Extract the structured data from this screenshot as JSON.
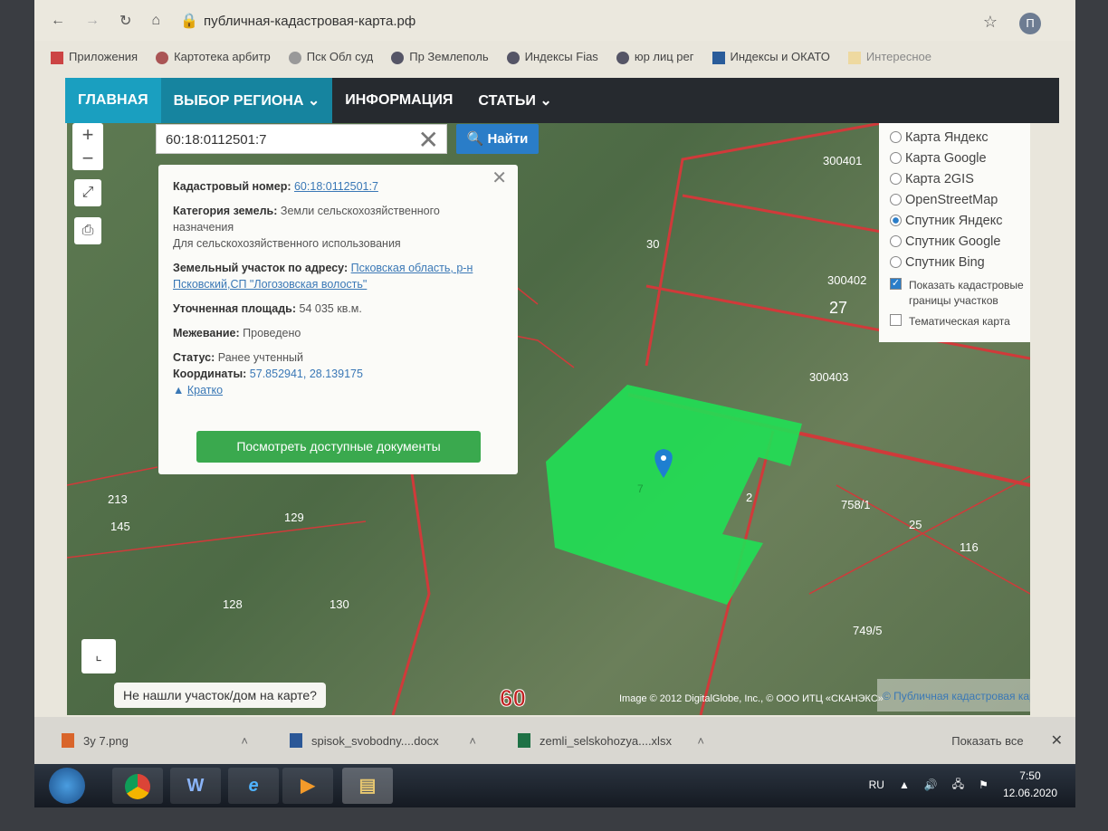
{
  "browser": {
    "url": "публичная-кадастровая-карта.рф",
    "profile_initial": "П",
    "bookmarks": [
      "Приложения",
      "Картотека арбитр",
      "Пск Обл суд",
      "Пр Землеполь",
      "Индексы Fias",
      "юр лиц рег",
      "Индексы и ОКАТО",
      "Интересное"
    ]
  },
  "nav": {
    "items": [
      "ГЛАВНАЯ",
      "ВЫБОР РЕГИОНА ⌄",
      "ИНФОРМАЦИЯ",
      "СТАТЬИ ⌄"
    ]
  },
  "search": {
    "value": "60:18:0112501:7",
    "button": "Найти"
  },
  "popup": {
    "cad_label": "Кадастровый номер:",
    "cad_value": "60:18:0112501:7",
    "cat_label": "Категория земель:",
    "cat_value": "Земли сельскохозяйственного назначения",
    "use_value": "Для сельскохозяйственного использования",
    "addr_label": "Земельный участок по адресу:",
    "addr_value": "Псковская область, р-н Псковский,СП \"Логозовская волость\"",
    "area_label": "Уточненная площадь:",
    "area_value": "54 035 кв.м.",
    "survey_label": "Межевание:",
    "survey_value": "Проведено",
    "status_label": "Статус:",
    "status_value": "Ранее учтенный",
    "coord_label": "Координаты:",
    "coord_value": "57.852941, 28.139175",
    "collapse": "Кратко",
    "docs_button": "Посмотреть доступные документы"
  },
  "layers": {
    "options": [
      "Карта Яндекс",
      "Карта Google",
      "Карта 2GIS",
      "OpenStreetMap",
      "Спутник Яндекс",
      "Спутник Google",
      "Спутник Bing"
    ],
    "selected": "Спутник Яндекс",
    "show_borders": "Показать кадастровые границы участков",
    "show_borders_checked": true,
    "thematic": "Тематическая карта",
    "thematic_checked": false
  },
  "map": {
    "labels": [
      "300401",
      "300402",
      "300403",
      "27",
      "60",
      "129",
      "128",
      "130",
      "25",
      "116",
      "758/1",
      "749/5",
      "213",
      "145",
      "30",
      "2"
    ],
    "parcel_label": "7",
    "not_found": "Не нашли участок/дом на карте?",
    "attribution": "Image © 2012 DigitalGlobe, Inc., © ООО ИТЦ «СКАНЭКС»",
    "attribution2": "© Публичная кадастровая карта",
    "highlight_color": "#22dd55",
    "border_color": "#d03a3a"
  },
  "downloads": {
    "items": [
      "3у 7.png",
      "spisok_svobodny....docx",
      "zemli_selskohozya....xlsx"
    ],
    "show_all": "Показать все"
  },
  "taskbar": {
    "lang": "RU",
    "time": "7:50",
    "date": "12.06.2020"
  }
}
